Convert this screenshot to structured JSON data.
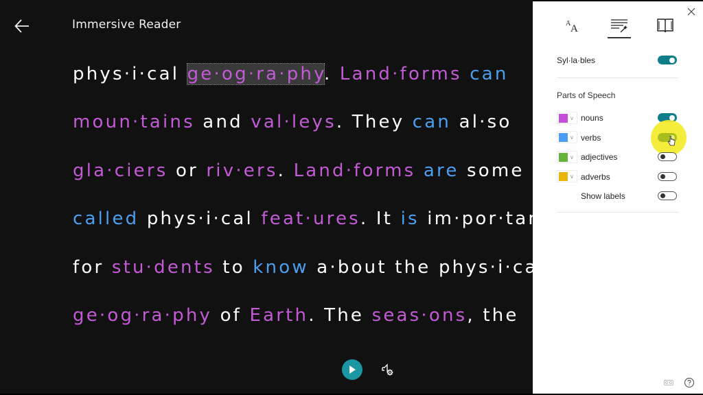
{
  "app": {
    "title": "Immersive Reader"
  },
  "reader": {
    "lines": [
      [
        {
          "t": "phys·i·cal",
          "c": "w"
        },
        {
          "t": " ",
          "c": "w"
        },
        {
          "t": "ge·og·ra·phy",
          "c": "noun",
          "sel": true
        },
        {
          "t": ". ",
          "c": "punct"
        },
        {
          "t": "Land·forms",
          "c": "noun"
        },
        {
          "t": " ",
          "c": "w"
        },
        {
          "t": "can",
          "c": "verb"
        }
      ],
      [
        {
          "t": "moun·tains",
          "c": "noun"
        },
        {
          "t": " and ",
          "c": "w"
        },
        {
          "t": "val·leys",
          "c": "noun"
        },
        {
          "t": ". They ",
          "c": "w"
        },
        {
          "t": "can",
          "c": "verb"
        },
        {
          "t": " al·so",
          "c": "w"
        }
      ],
      [
        {
          "t": "gla·ciers",
          "c": "noun"
        },
        {
          "t": " or ",
          "c": "w"
        },
        {
          "t": "riv·ers",
          "c": "noun"
        },
        {
          "t": ". ",
          "c": "punct"
        },
        {
          "t": "Land·forms",
          "c": "noun"
        },
        {
          "t": " ",
          "c": "w"
        },
        {
          "t": "are",
          "c": "verb"
        },
        {
          "t": " some",
          "c": "w"
        }
      ],
      [
        {
          "t": "called",
          "c": "verb"
        },
        {
          "t": " phys·i·cal ",
          "c": "w"
        },
        {
          "t": "feat·ures",
          "c": "noun"
        },
        {
          "t": ". It ",
          "c": "w"
        },
        {
          "t": "is",
          "c": "verb"
        },
        {
          "t": " im·por·tant",
          "c": "w"
        }
      ],
      [
        {
          "t": "for ",
          "c": "w"
        },
        {
          "t": "stu·dents",
          "c": "noun"
        },
        {
          "t": " to ",
          "c": "w"
        },
        {
          "t": "know",
          "c": "verb"
        },
        {
          "t": " a·bout the phys·i·cal",
          "c": "w"
        }
      ],
      [
        {
          "t": "ge·og·ra·phy",
          "c": "noun"
        },
        {
          "t": " of ",
          "c": "w"
        },
        {
          "t": "Earth",
          "c": "noun"
        },
        {
          "t": ". The ",
          "c": "w"
        },
        {
          "t": "seas·ons",
          "c": "noun"
        },
        {
          "t": ", the",
          "c": "w"
        }
      ]
    ]
  },
  "controls": {
    "play_icon": "play-icon",
    "voice_settings_icon": "voice-settings-icon"
  },
  "panel": {
    "tabs": [
      {
        "name": "text-preferences",
        "icon": "text-size-icon",
        "active": false
      },
      {
        "name": "grammar-options",
        "icon": "grammar-wand-icon",
        "active": true
      },
      {
        "name": "reading-preferences",
        "icon": "book-icon",
        "active": false
      }
    ],
    "syllables": {
      "label": "Syl·la·bles",
      "on": true
    },
    "parts_of_speech": {
      "title": "Parts of Speech",
      "items": [
        {
          "label": "nouns",
          "color": "#c54fd9",
          "on": true
        },
        {
          "label": "verbs",
          "color": "#4a9ff2",
          "on": true
        },
        {
          "label": "adjectives",
          "color": "#63b43a",
          "on": false
        },
        {
          "label": "adverbs",
          "color": "#e7b40c",
          "on": false
        }
      ],
      "show_labels": {
        "label": "Show labels",
        "on": false
      }
    }
  },
  "colors": {
    "accent": "#0e7f8a",
    "noun": "#c35bd6",
    "verb": "#4b9ff0",
    "background": "#111111"
  }
}
